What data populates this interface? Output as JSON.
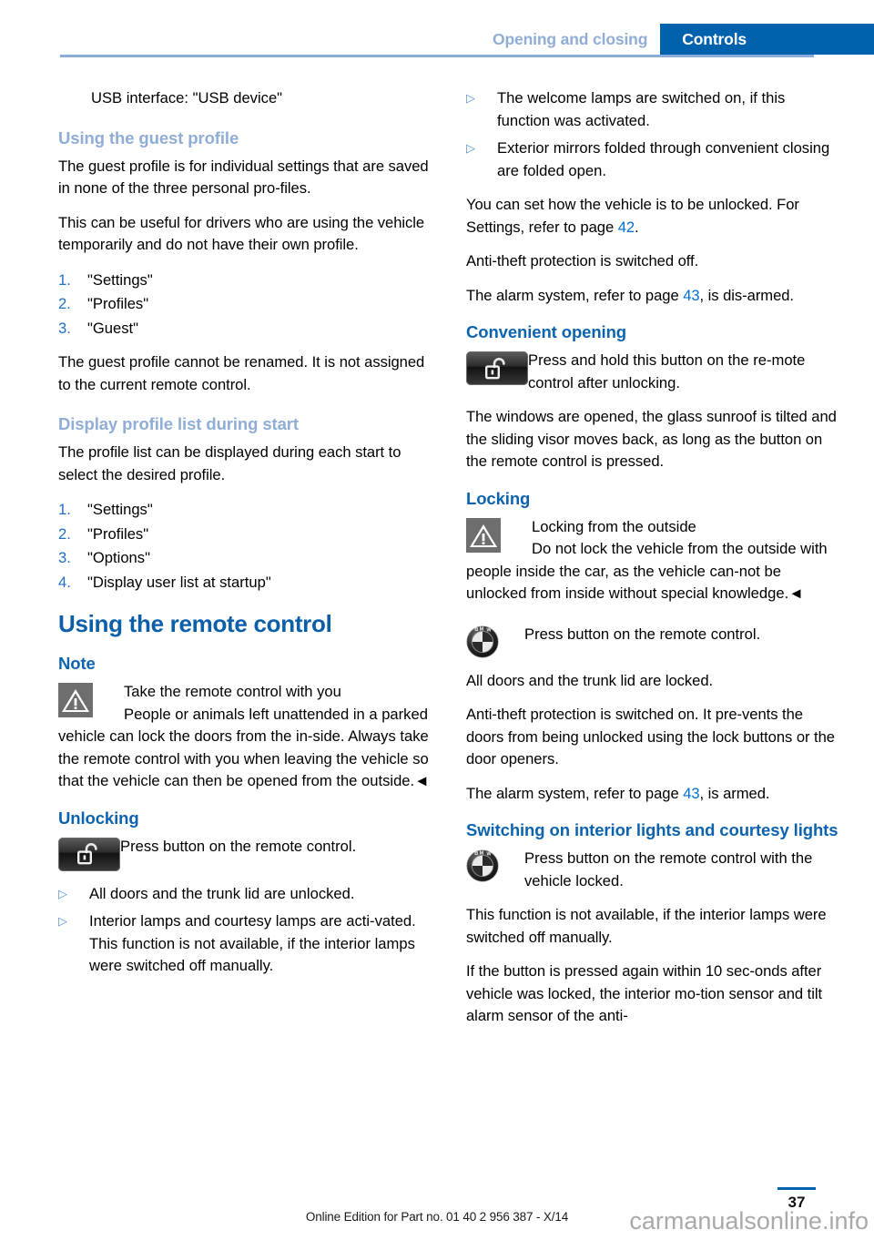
{
  "header": {
    "tab_inactive": "Opening and closing",
    "tab_active": "Controls",
    "accent_blue": "#0061ad",
    "muted_blue": "#90add6"
  },
  "left_column": {
    "intro_indented": "USB interface: \"USB device\"",
    "guest_profile": {
      "heading": "Using the guest profile",
      "para_1": "The guest profile is for individual settings that are saved in none of the three personal pro‑files.",
      "para_2": "This can be useful for drivers who are using the vehicle temporarily and do not have their own profile.",
      "steps": [
        {
          "num": "1.",
          "label": "\"Settings\""
        },
        {
          "num": "2.",
          "label": "\"Profiles\""
        },
        {
          "num": "3.",
          "label": "\"Guest\""
        }
      ],
      "para_3": "The guest profile cannot be renamed. It is not assigned to the current remote control."
    },
    "display_profile_list": {
      "heading": "Display profile list during start",
      "para_1": "The profile list can be displayed during each start to select the desired profile.",
      "steps": [
        {
          "num": "1.",
          "label": "\"Settings\""
        },
        {
          "num": "2.",
          "label": "\"Profiles\""
        },
        {
          "num": "3.",
          "label": "\"Options\""
        },
        {
          "num": "4.",
          "label": "\"Display user list at startup\""
        }
      ]
    },
    "remote_control": {
      "chapter_heading": "Using the remote control",
      "note_heading": "Note",
      "note_title": "Take the remote control with you",
      "note_body": "People or animals left unattended in a parked vehicle can lock the doors from the in‑side. Always take the remote control with you when leaving the vehicle so that the vehicle can then be opened from the outside.",
      "note_end": "◄"
    },
    "unlocking": {
      "heading": "Unlocking",
      "button_caption": "Press button on the remote control.",
      "bullets": [
        "All doors and the trunk lid are unlocked.",
        "Interior lamps and courtesy lamps are acti‑vated. This function is not available, if the interior lamps were switched off manually."
      ]
    }
  },
  "right_column": {
    "unlock_results": {
      "bullets": [
        "The welcome lamps are switched on, if this function was activated.",
        "Exterior mirrors folded through convenient closing are folded open."
      ],
      "para_1_a": "You can set how the vehicle is to be unlocked. For Settings, refer to page ",
      "para_1_ref": "42",
      "para_1_b": ".",
      "para_2": "Anti-theft protection is switched off.",
      "para_3_a": "The alarm system, refer to page ",
      "para_3_ref": "43",
      "para_3_b": ", is dis‑armed."
    },
    "convenient_opening": {
      "heading": "Convenient opening",
      "button_caption": "Press and hold this button on the re‑mote control after unlocking.",
      "para_1": "The windows are opened, the glass sunroof is tilted and the sliding visor moves back, as long as the button on the remote control is pressed."
    },
    "locking": {
      "heading": "Locking",
      "warn_title": "Locking from the outside",
      "warn_body": "Do not lock the vehicle from the outside with people inside the car, as the vehicle can‑not be unlocked from inside without special knowledge.",
      "warn_end": "◄",
      "bmw_caption": "Press button on the remote control.",
      "para_1": "All doors and the trunk lid are locked.",
      "para_2": "Anti-theft protection is switched on. It pre‑vents the doors from being unlocked using the lock buttons or the door openers.",
      "para_3_a": "The alarm system, refer to page ",
      "para_3_ref": "43",
      "para_3_b": ", is armed."
    },
    "interior_lights": {
      "heading": "Switching on interior lights and courtesy lights",
      "bmw_caption": "Press button on the remote control with the vehicle locked.",
      "para_1": "This function is not available, if the interior lamps were switched off manually.",
      "para_2": "If the button is pressed again within 10 sec‑onds after vehicle was locked, the interior mo‑tion sensor and tilt alarm sensor of the anti-"
    }
  },
  "footer": {
    "edition_text": "Online Edition for Part no. 01 40 2 956 387 - X/14",
    "page_number": "37",
    "watermark": "carmanualsonline.info"
  }
}
